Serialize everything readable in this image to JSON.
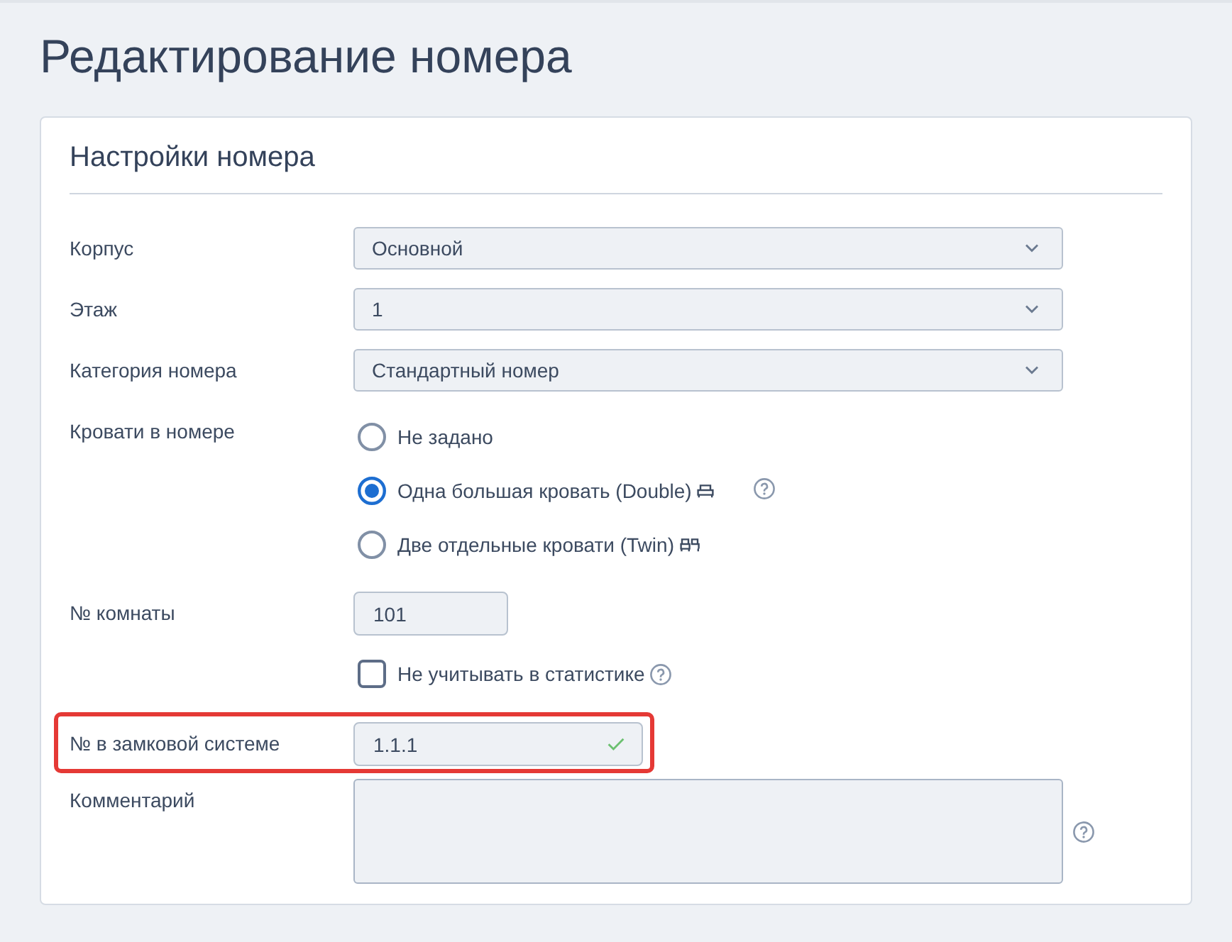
{
  "page": {
    "title": "Редактирование номера"
  },
  "form": {
    "title": "Настройки номера",
    "rows": [
      {
        "kind": "select",
        "label": "Корпус",
        "value": "Основной"
      },
      {
        "kind": "select",
        "label": "Этаж",
        "value": "1"
      },
      {
        "kind": "select",
        "label": "Категория номера",
        "value": "Стандартный номер"
      },
      {
        "kind": "radio_group",
        "label": "Кровати в номере",
        "options": [
          {
            "kind": "plain",
            "label": "Не задано",
            "selected": false,
            "help": false
          },
          {
            "kind": "double",
            "label": "Одна большая кровать (Double)",
            "selected": true,
            "help": true
          },
          {
            "kind": "twin",
            "label": "Две отдельные кровати (Twin)",
            "selected": false,
            "help": false
          }
        ]
      },
      {
        "kind": "number",
        "label": "№ комнаты",
        "value": "101"
      },
      {
        "kind": "checkbox",
        "label": "Не учитывать в статистике",
        "checked": false,
        "help": true
      },
      {
        "kind": "text",
        "label": "№ в замковой системе",
        "value": "1.1.1",
        "valid": true,
        "highlighted": true
      },
      {
        "kind": "textarea",
        "label": "Комментарий",
        "help": true
      }
    ]
  }
}
